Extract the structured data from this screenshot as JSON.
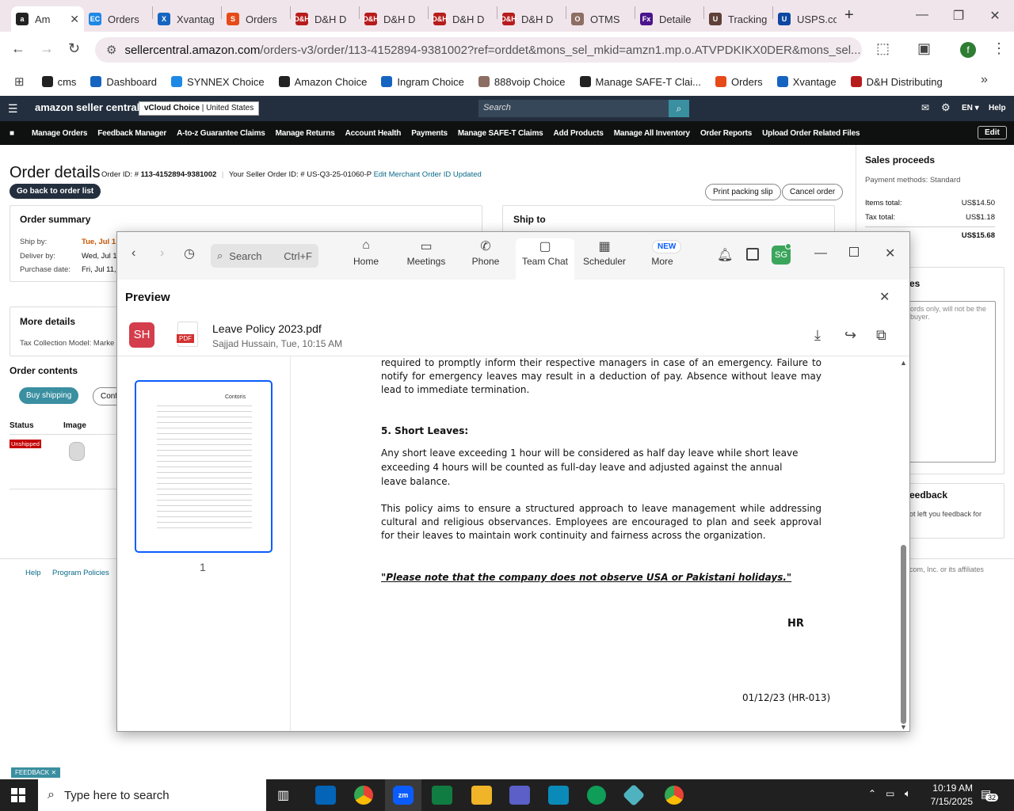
{
  "browser": {
    "tabs": [
      {
        "title": "Am",
        "color": "#222",
        "glyph": "a",
        "active": true
      },
      {
        "title": "Orders",
        "color": "#1e88e5",
        "glyph": "EC"
      },
      {
        "title": "Xvantag",
        "color": "#1565c0",
        "glyph": "X"
      },
      {
        "title": "Orders",
        "color": "#e64a19",
        "glyph": "S"
      },
      {
        "title": "D&H D",
        "color": "#b71c1c",
        "glyph": "D&H"
      },
      {
        "title": "D&H D",
        "color": "#b71c1c",
        "glyph": "D&H"
      },
      {
        "title": "D&H D",
        "color": "#b71c1c",
        "glyph": "D&H"
      },
      {
        "title": "D&H D",
        "color": "#b71c1c",
        "glyph": "D&H"
      },
      {
        "title": "OTMS",
        "color": "#8d6e63",
        "glyph": "O"
      },
      {
        "title": "Detaile",
        "color": "#4a148c",
        "glyph": "Fx"
      },
      {
        "title": "Tracking",
        "color": "#5d4037",
        "glyph": "U"
      },
      {
        "title": "USPS.co",
        "color": "#0d47a1",
        "glyph": "U"
      }
    ],
    "new_tab": "+",
    "url_host": "sellercentral.amazon.com",
    "url_rest": "/orders-v3/order/113-4152894-9381002?ref=orddet&mons_sel_mkid=amzn1.mp.o.ATVPDKIKX0DER&mons_sel...",
    "profile_initial": "f",
    "bookmarks": [
      {
        "label": "cms",
        "color": "#222"
      },
      {
        "label": "Dashboard",
        "color": "#1565c0"
      },
      {
        "label": "SYNNEX Choice",
        "color": "#1e88e5"
      },
      {
        "label": "Amazon Choice",
        "color": "#222"
      },
      {
        "label": "Ingram Choice",
        "color": "#1565c0"
      },
      {
        "label": "888voip Choice",
        "color": "#8d6e63"
      },
      {
        "label": "Manage SAFE-T Clai...",
        "color": "#222"
      },
      {
        "label": "Orders",
        "color": "#e64a19"
      },
      {
        "label": "Xvantage",
        "color": "#1565c0"
      },
      {
        "label": "D&H Distributing",
        "color": "#b71c1c"
      }
    ]
  },
  "seller": {
    "brand": "amazon seller central",
    "store": "vCloud Choice",
    "marketplace": "United States",
    "search_placeholder": "Search",
    "lang": "EN",
    "help": "Help",
    "nav": [
      "Manage Orders",
      "Feedback Manager",
      "A-to-z Guarantee Claims",
      "Manage Returns",
      "Account Health",
      "Payments",
      "Manage SAFE-T Claims",
      "Add Products",
      "Manage All Inventory",
      "Order Reports",
      "Upload Order Related Files"
    ],
    "edit": "Edit",
    "page_title": "Order details",
    "order_id_label": "Order ID: #",
    "order_id": "113-4152894-9381002",
    "seller_order_label": "Your Seller Order ID: #",
    "seller_order_id": "US-Q3-25-01060-P",
    "edit_merchant": "Edit Merchant Order ID",
    "updated": "Updated",
    "back": "Go back to order list",
    "print_slip": "Print packing slip",
    "cancel_order": "Cancel order",
    "summary_title": "Order summary",
    "ship_by_label": "Ship by:",
    "ship_by": "Tue, Jul 1",
    "deliver_by_label": "Deliver by:",
    "deliver_by": "Wed, Jul 1",
    "purchase_label": "Purchase date:",
    "purchase": "Fri, Jul 11,",
    "ship_to": "Ship to",
    "more_details": "More details",
    "tax_model": "Tax Collection Model: Marke",
    "order_contents": "Order contents",
    "buy_shipping": "Buy shipping",
    "confirm": "Confi",
    "col_status": "Status",
    "col_image": "Image",
    "status_badge": "Unshipped",
    "footer_help": "Help",
    "footer_policies": "Program Policies",
    "footer_copy": "com, Inc. or its affiliates",
    "feedback_tab": "FEEDBACK",
    "proceeds_title": "Sales proceeds",
    "payment_methods": "Payment methods: Standard",
    "items_total_label": "Items total:",
    "items_total": "US$14.50",
    "tax_total_label": "Tax total:",
    "tax_total": "US$1.18",
    "grand_total": "US$15.68",
    "notes_title": "es",
    "notes_placeholder": "ords only, will not be the buyer.",
    "feedback_title": "eedback",
    "feedback_text": "ot left you feedback for"
  },
  "zoom": {
    "search": "Search",
    "search_shortcut": "Ctrl+F",
    "tabs": [
      {
        "label": "Home",
        "icon": "⌂"
      },
      {
        "label": "Meetings",
        "icon": "▭"
      },
      {
        "label": "Phone",
        "icon": "✆"
      },
      {
        "label": "Team Chat",
        "icon": "▢"
      },
      {
        "label": "Scheduler",
        "icon": "▦"
      },
      {
        "label": "More",
        "icon": "⋯"
      }
    ],
    "new_badge": "NEW",
    "avatar": "SG",
    "preview_title": "Preview",
    "sender_initials": "SH",
    "file_badge": "PDF",
    "file_name": "Leave Policy 2023.pdf",
    "file_meta": "Sajjad Hussain, Tue, 10:15 AM",
    "page_number": "1",
    "thumb_logo": "Contoris",
    "pdf": {
      "p1": "required to promptly inform their respective managers in case of an emergency. Failure to notify for emergency leaves may result in a deduction of pay. Absence without leave may lead to immediate termination.",
      "h5": "5. Short Leaves:",
      "p2": "Any short leave exceeding 1 hour will be considered as half day leave while short leave exceeding 4 hours will be counted as full-day leave and adjusted against the annual leave balance.",
      "p3": "This policy aims to ensure a structured approach to leave management while addressing cultural and religious observances. Employees are encouraged to plan and seek approval for their leaves to maintain work continuity and fairness across the organization.",
      "note": "\"Please note that the company does not observe USA or Pakistani holidays.\"",
      "sign": "HR",
      "date": "01/12/23 (HR-013)"
    }
  },
  "taskbar": {
    "search_placeholder": "Type here to search",
    "time": "10:19 AM",
    "date": "7/15/2025",
    "notif_count": "32"
  }
}
